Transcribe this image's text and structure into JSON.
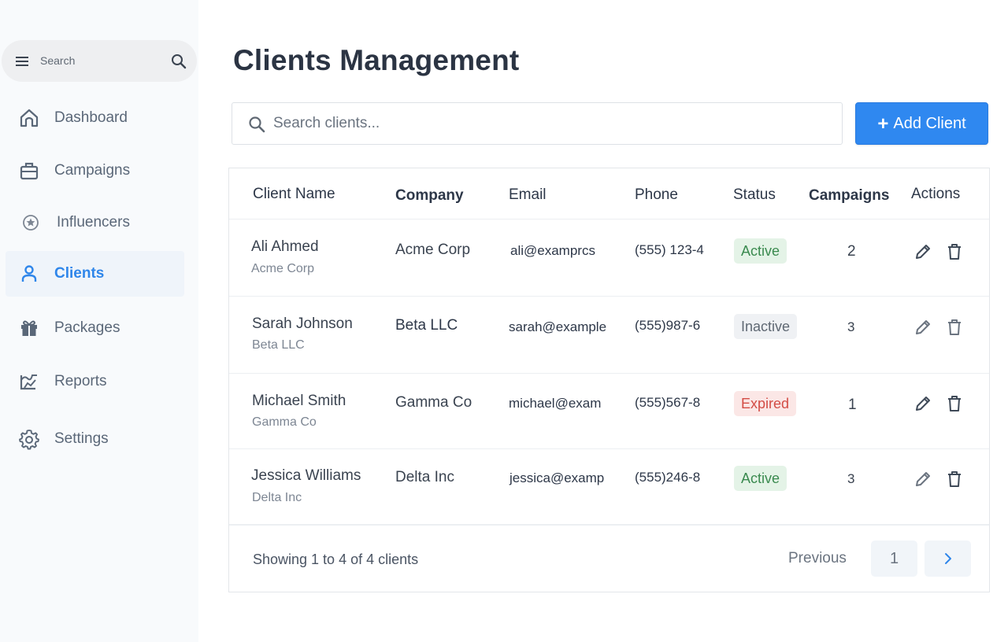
{
  "sidebar": {
    "search_label": "Search",
    "items": [
      {
        "label": "Dashboard",
        "icon": "home-icon"
      },
      {
        "label": "Campaigns",
        "icon": "briefcase-icon"
      },
      {
        "label": "Influencers",
        "icon": "star-circle-icon"
      },
      {
        "label": "Clients",
        "icon": "user-icon",
        "active": true
      },
      {
        "label": "Packages",
        "icon": "gift-icon"
      },
      {
        "label": "Reports",
        "icon": "chart-icon"
      },
      {
        "label": "Settings",
        "icon": "gear-icon"
      }
    ]
  },
  "main": {
    "title": "Clients Management",
    "search_placeholder": "Search clients...",
    "add_button_label": "Add Client"
  },
  "table": {
    "headers": [
      "Client Name",
      "Company",
      "Email",
      "Phone",
      "Status",
      "Campaigns",
      "Actions"
    ],
    "rows": [
      {
        "name": "Ali Ahmed",
        "sub": "Acme Corp",
        "company": "Acme Corp",
        "email": "ali@examprcs",
        "phone": "(555) 123-4",
        "status": "Active",
        "campaigns": "2"
      },
      {
        "name": "Sarah Johnson",
        "sub": "Beta LLC",
        "company": "Beta LLC",
        "email": "sarah@example",
        "phone": "(555)987-6",
        "status": "Inactive",
        "campaigns": "3"
      },
      {
        "name": "Michael Smith",
        "sub": "Gamma Co",
        "company": "Gamma Co",
        "email": "michael@exam",
        "phone": "(555)567-8",
        "status": "Expired",
        "campaigns": "1"
      },
      {
        "name": "Jessica Williams",
        "sub": "Delta Inc",
        "company": "Delta Inc",
        "email": "jessica@examp",
        "phone": "(555)246-8",
        "status": "Active",
        "campaigns": "3"
      }
    ]
  },
  "pagination": {
    "summary": "Showing 1 to 4 of 4 clients",
    "previous_label": "Previous",
    "current_page": "1"
  },
  "colors": {
    "accent": "#2f88f0",
    "active_badge": "#e4f3e7",
    "inactive_badge": "#eff1f4",
    "expired_badge": "#fbe7e6"
  }
}
